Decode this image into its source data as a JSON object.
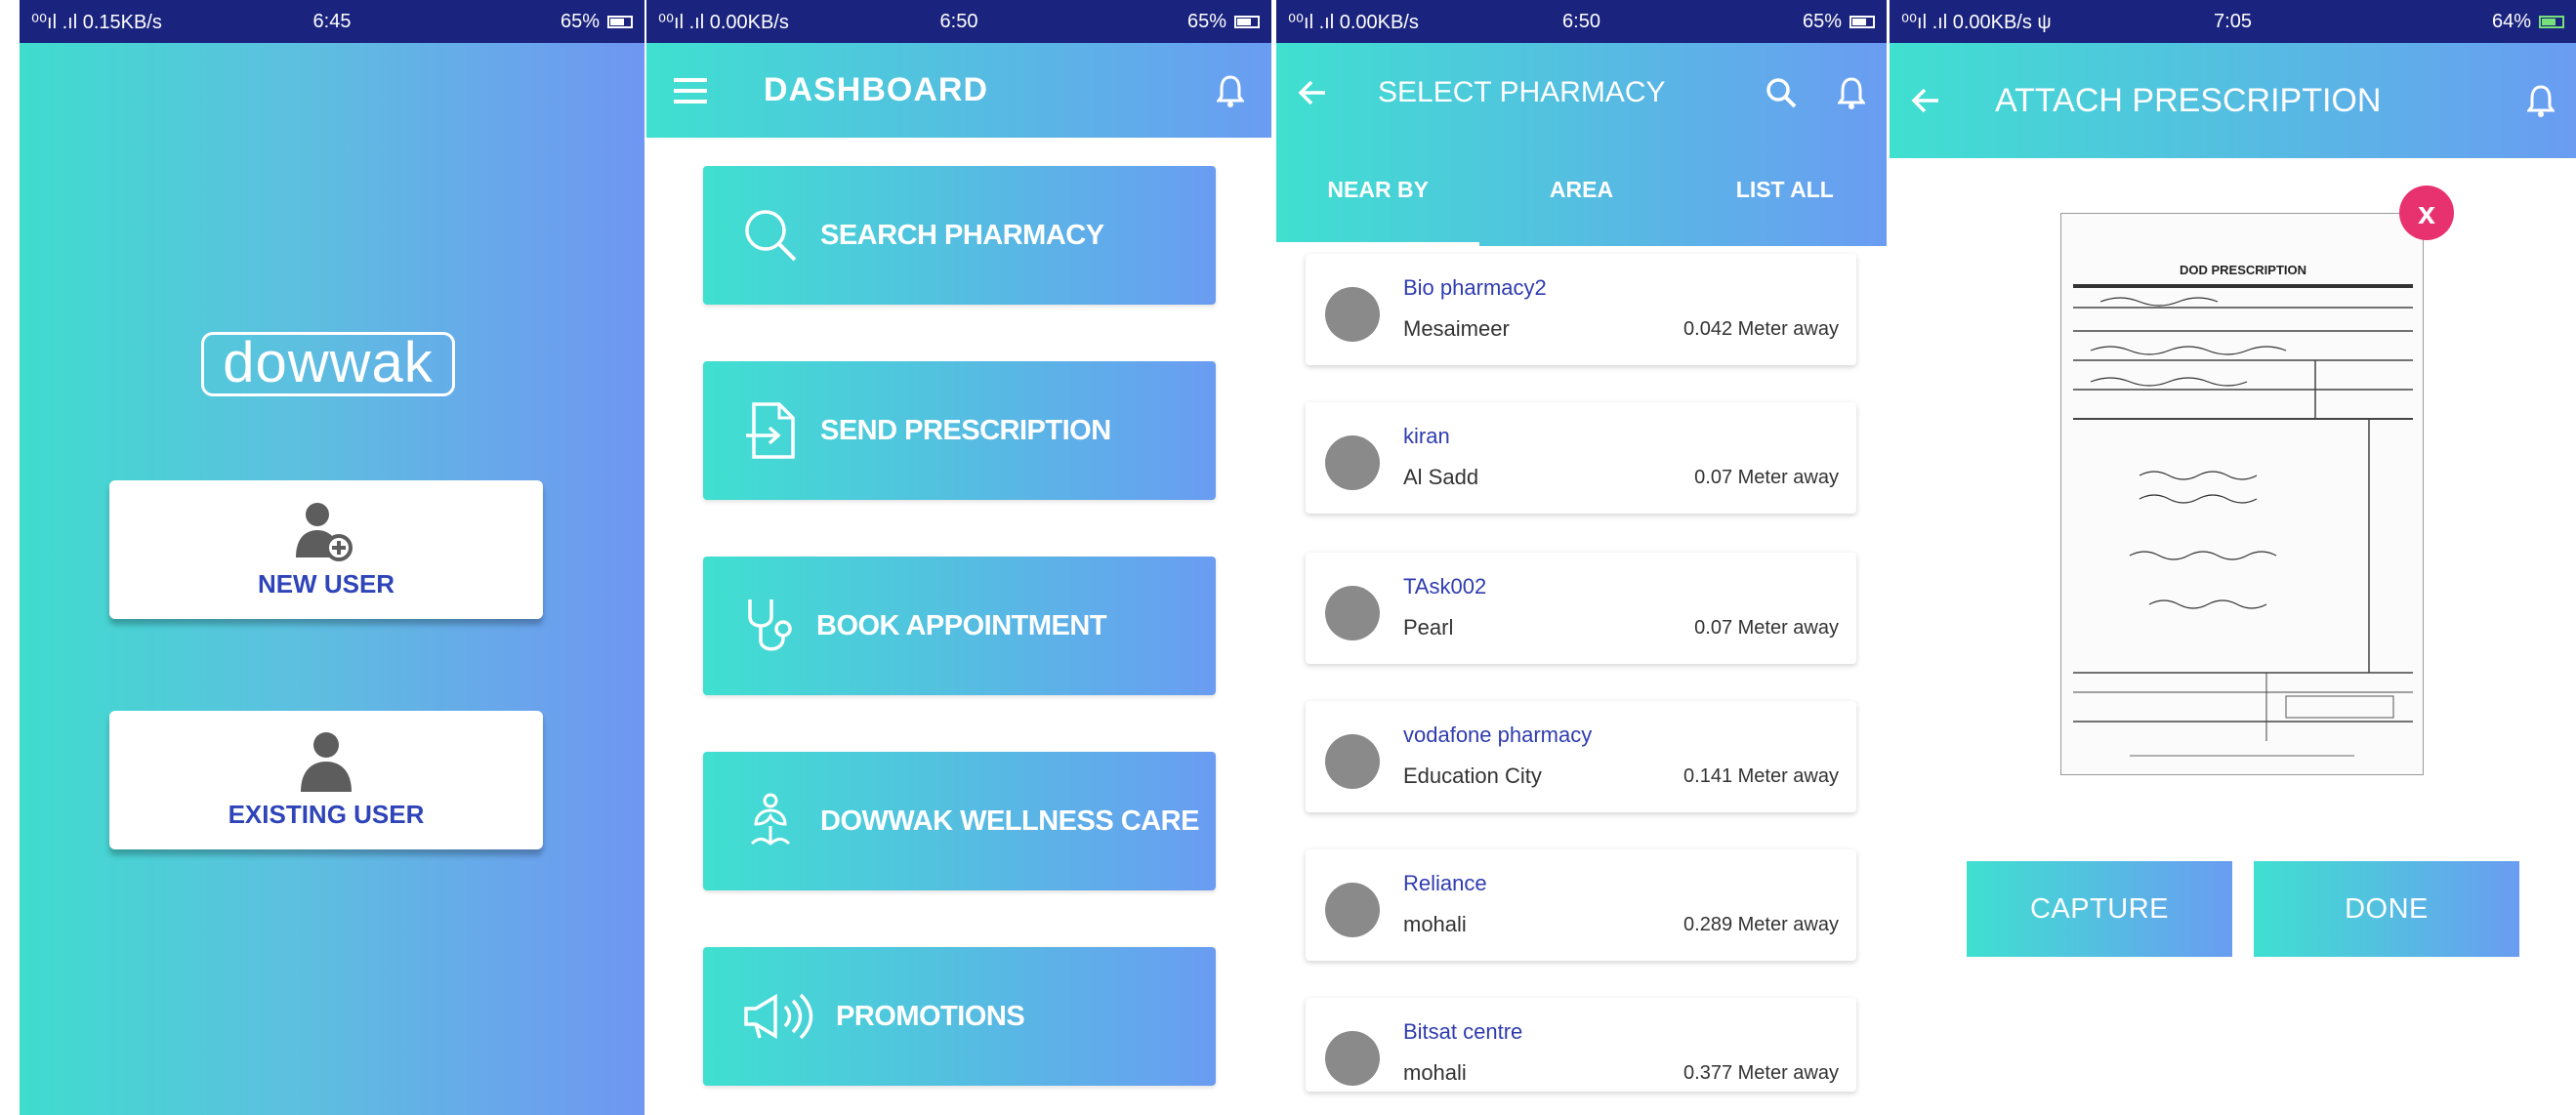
{
  "colors": {
    "status_bar": "#1a237e",
    "gradient_start": "#3fe0d0",
    "gradient_end": "#6a9cf2",
    "link_blue": "#2f3cb0",
    "close_pink": "#e8326f"
  },
  "screens": [
    {
      "status": {
        "left": "⁰⁰ıl .ıl 0.15KB/s",
        "time": "6:45",
        "battery": "65%"
      },
      "logo": "dowwak",
      "new_user_label": "NEW USER",
      "existing_user_label": "EXISTING USER"
    },
    {
      "status": {
        "left": "⁰⁰ıl .ıl 0.00KB/s",
        "time": "6:50",
        "battery": "65%"
      },
      "title": "DASHBOARD",
      "buttons": [
        {
          "label": "SEARCH PHARMACY",
          "icon": "search-icon"
        },
        {
          "label": "SEND PRESCRIPTION",
          "icon": "document-arrow-icon"
        },
        {
          "label": "BOOK APPOINTMENT",
          "icon": "stethoscope-icon"
        },
        {
          "label": "DOWWAK WELLNESS CARE",
          "icon": "lotus-icon"
        },
        {
          "label": "PROMOTIONS",
          "icon": "megaphone-icon"
        }
      ]
    },
    {
      "status": {
        "left": "⁰⁰ıl .ıl 0.00KB/s",
        "time": "6:50",
        "battery": "65%"
      },
      "title": "SELECT PHARMACY",
      "tabs": [
        "NEAR BY",
        "AREA",
        "LIST ALL"
      ],
      "pharmacies": [
        {
          "name": "Bio pharmacy2",
          "area": "Mesaimeer",
          "distance": "0.042 Meter away"
        },
        {
          "name": "kiran",
          "area": "Al Sadd",
          "distance": "0.07 Meter away"
        },
        {
          "name": "TAsk002",
          "area": "Pearl",
          "distance": "0.07 Meter away"
        },
        {
          "name": "vodafone pharmacy",
          "area": "Education City",
          "distance": "0.141 Meter away"
        },
        {
          "name": "Reliance",
          "area": "mohali",
          "distance": "0.289 Meter away"
        },
        {
          "name": "Bitsat centre",
          "area": "mohali",
          "distance": "0.377 Meter away"
        }
      ]
    },
    {
      "status": {
        "left": "⁰⁰ıl .ıl 0.00KB/s ψ",
        "time": "7:05",
        "battery": "64%"
      },
      "title": "ATTACH PRESCRIPTION",
      "doc_title": "DOD PRESCRIPTION",
      "close_glyph": "x",
      "capture_label": "CAPTURE",
      "done_label": "DONE"
    }
  ]
}
